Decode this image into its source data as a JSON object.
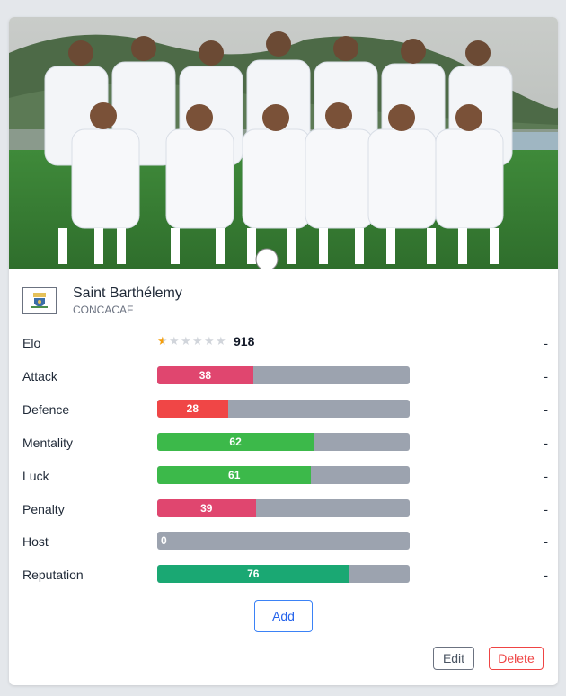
{
  "team": {
    "name": "Saint Barthélemy",
    "confederation": "CONCACAF",
    "photo_alt": "team-photo"
  },
  "colors": {
    "pink": "#e0466f",
    "red": "#ef4444",
    "green": "#3cb94a",
    "teal": "#1aa873",
    "track": "#9ca3af",
    "star_filled": "#f59e0b",
    "star_empty": "#d1d5db"
  },
  "elo": {
    "label": "Elo",
    "value": "918",
    "stars_total": 6,
    "stars_filled": 0.5,
    "dash": "-"
  },
  "stats": [
    {
      "label": "Attack",
      "value": "38",
      "percent": 38,
      "color": "#e0466f",
      "dash": "-"
    },
    {
      "label": "Defence",
      "value": "28",
      "percent": 28,
      "color": "#f04646",
      "dash": "-"
    },
    {
      "label": "Mentality",
      "value": "62",
      "percent": 62,
      "color": "#3cb94a",
      "dash": "-"
    },
    {
      "label": "Luck",
      "value": "61",
      "percent": 61,
      "color": "#3cb94a",
      "dash": "-"
    },
    {
      "label": "Penalty",
      "value": "39",
      "percent": 39,
      "color": "#e0466f",
      "dash": "-"
    },
    {
      "label": "Host",
      "value": "0",
      "percent": 0,
      "color": "#9ca3af",
      "dash": "-"
    },
    {
      "label": "Reputation",
      "value": "76",
      "percent": 76,
      "color": "#1aa873",
      "dash": "-"
    }
  ],
  "buttons": {
    "add": "Add",
    "edit": "Edit",
    "delete": "Delete"
  }
}
